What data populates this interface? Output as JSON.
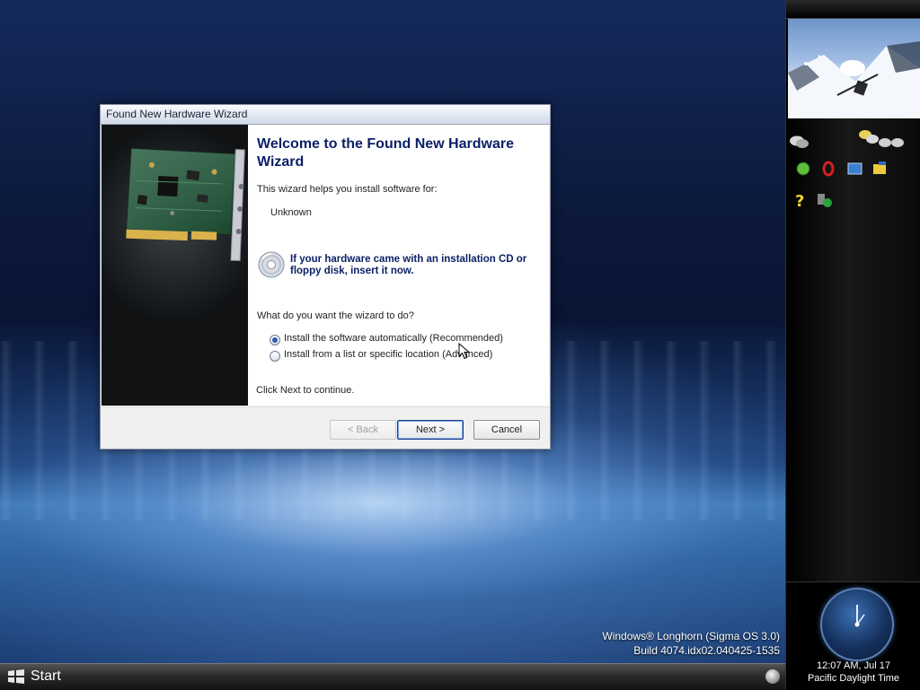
{
  "wizard": {
    "window_title": "Found New Hardware Wizard",
    "heading": "Welcome to the Found New Hardware Wizard",
    "intro": "This wizard helps you install software for:",
    "device_name": "Unknown",
    "cd_prompt": "If your hardware came with an installation CD or floppy disk, insert it now.",
    "question": "What do you want the wizard to do?",
    "options": [
      {
        "label": "Install the software automatically (Recommended)",
        "selected": true
      },
      {
        "label": "Install from a list or specific location (Advanced)",
        "selected": false
      }
    ],
    "footer_text": "Click Next to continue.",
    "buttons": {
      "back": "< Back",
      "next": "Next >",
      "cancel": "Cancel"
    }
  },
  "desktop": {
    "version_line1": "Windows® Longhorn (Sigma OS 3.0)",
    "version_line2": "Build 4074.idx02.040425-1535"
  },
  "sidebar": {
    "clock_time": "12:07 AM, Jul 17",
    "clock_zone": "Pacific Daylight Time"
  },
  "taskbar": {
    "start_label": "Start"
  }
}
